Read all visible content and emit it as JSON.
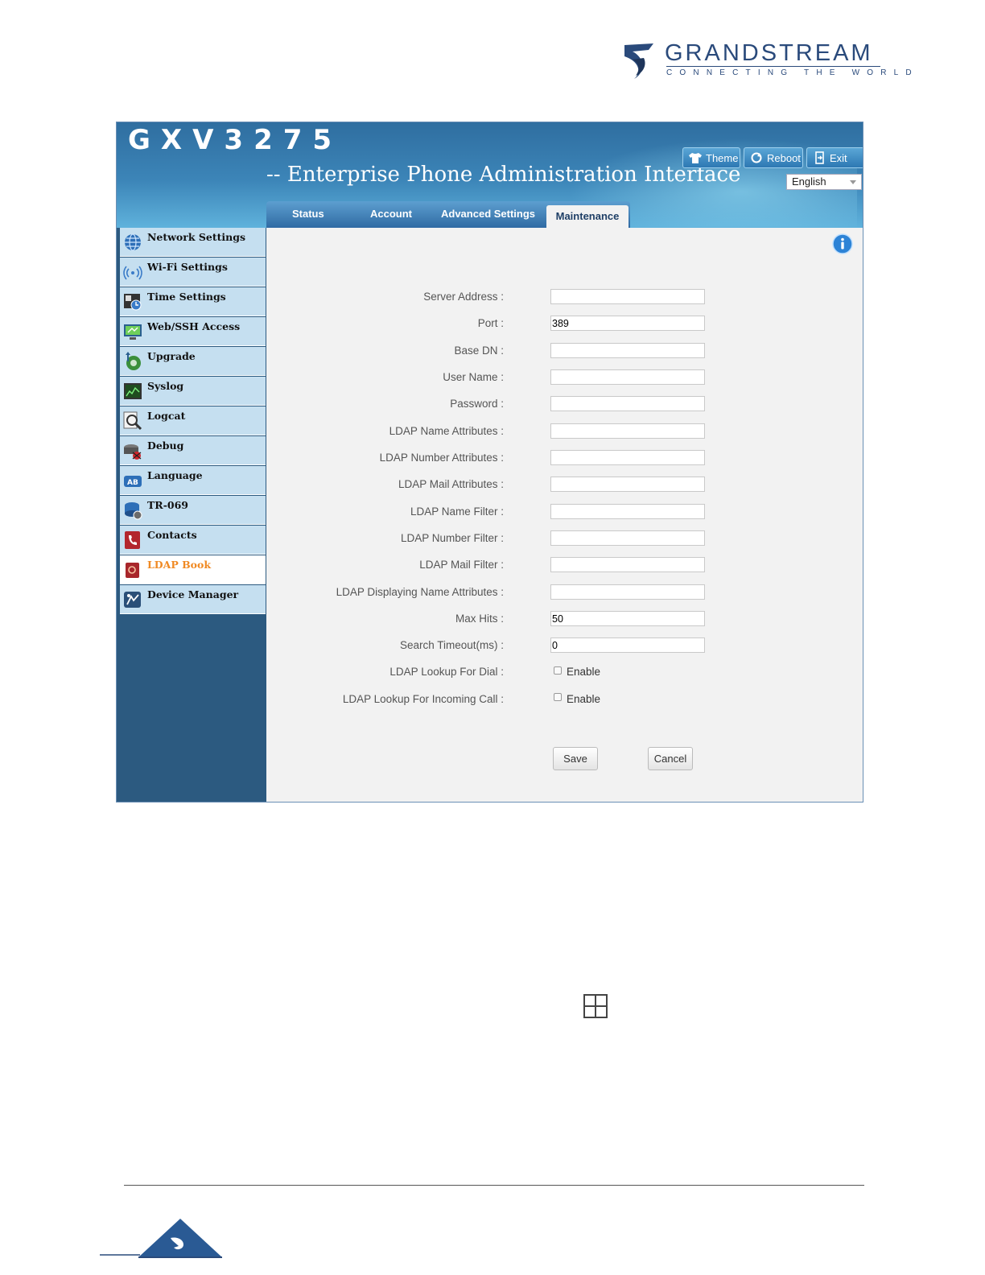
{
  "brand": {
    "name": "GRANDSTREAM",
    "tagline": "CONNECTING THE WORLD",
    "color": "#2a4a7b"
  },
  "app": {
    "model": "GXV3275",
    "subtitle": "-- Enterprise Phone Administration Interface",
    "buttons": {
      "theme": "Theme",
      "reboot": "Reboot",
      "exit": "Exit"
    },
    "language": "English",
    "tabs": [
      {
        "label": "Status"
      },
      {
        "label": "Account"
      },
      {
        "label": "Advanced Settings"
      },
      {
        "label": "Maintenance",
        "active": true
      }
    ]
  },
  "sidebar": {
    "items": [
      {
        "label": "Network Settings",
        "icon": "globe-icon"
      },
      {
        "label": "Wi-Fi Settings",
        "icon": "wifi-icon"
      },
      {
        "label": "Time Settings",
        "icon": "clock-icon"
      },
      {
        "label": "Web/SSH Access",
        "icon": "monitor-icon"
      },
      {
        "label": "Upgrade",
        "icon": "upgrade-icon"
      },
      {
        "label": "Syslog",
        "icon": "chart-screen-icon"
      },
      {
        "label": "Logcat",
        "icon": "magnifier-icon"
      },
      {
        "label": "Debug",
        "icon": "bug-icon"
      },
      {
        "label": "Language",
        "icon": "language-icon"
      },
      {
        "label": "TR-069",
        "icon": "tr069-icon"
      },
      {
        "label": "Contacts",
        "icon": "phonebook-icon"
      },
      {
        "label": "LDAP Book",
        "icon": "ldap-book-icon",
        "active": true
      },
      {
        "label": "Device Manager",
        "icon": "device-manager-icon"
      }
    ]
  },
  "form": {
    "fields": [
      {
        "label": "Server Address :",
        "value": ""
      },
      {
        "label": "Port :",
        "value": "389"
      },
      {
        "label": "Base DN :",
        "value": ""
      },
      {
        "label": "User Name :",
        "value": ""
      },
      {
        "label": "Password :",
        "value": ""
      },
      {
        "label": "LDAP Name Attributes :",
        "value": ""
      },
      {
        "label": "LDAP Number Attributes :",
        "value": ""
      },
      {
        "label": "LDAP Mail Attributes :",
        "value": ""
      },
      {
        "label": "LDAP Name Filter :",
        "value": ""
      },
      {
        "label": "LDAP Number Filter :",
        "value": ""
      },
      {
        "label": "LDAP Mail Filter :",
        "value": ""
      },
      {
        "label": "LDAP Displaying Name Attributes :",
        "value": ""
      },
      {
        "label": "Max Hits :",
        "value": "50"
      },
      {
        "label": "Search Timeout(ms) :",
        "value": "0"
      }
    ],
    "checkboxes": [
      {
        "label": "LDAP Lookup For Dial :",
        "option": "Enable",
        "checked": false
      },
      {
        "label": "LDAP Lookup For Incoming Call :",
        "option": "Enable",
        "checked": false
      }
    ],
    "save": "Save",
    "cancel": "Cancel"
  },
  "colors": {
    "header": "#3c85b8",
    "sidebar_bg": "#2c5a80",
    "sidebar_item": "#c5dff0",
    "active_item": "#f08a24"
  }
}
